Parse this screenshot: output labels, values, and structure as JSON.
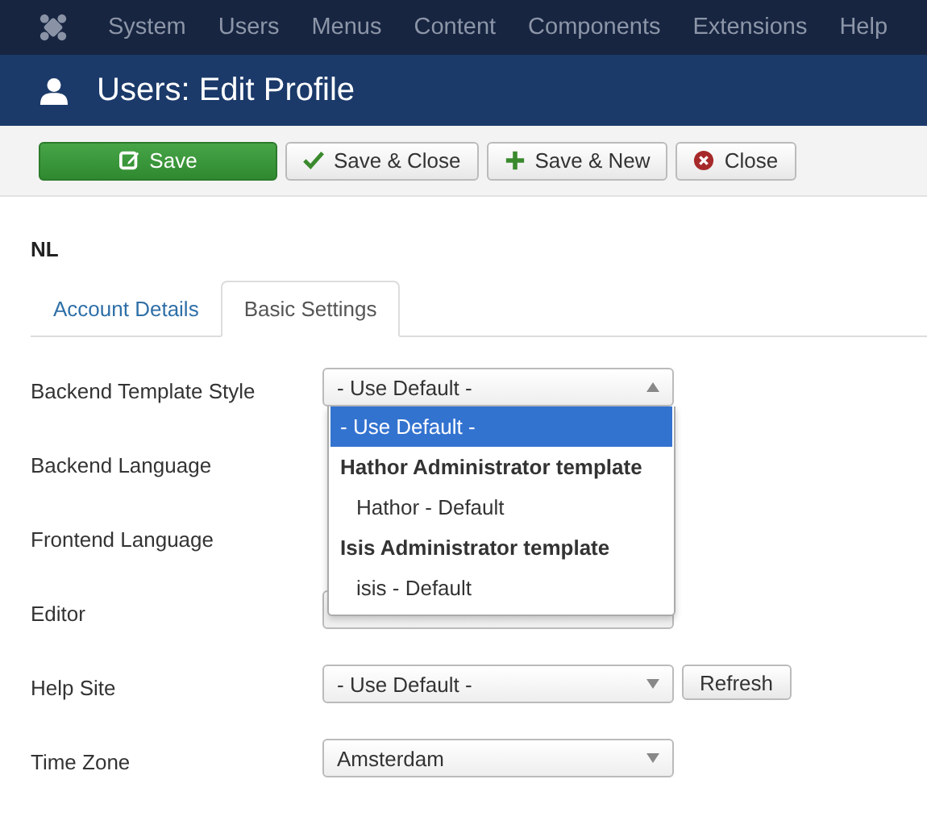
{
  "menu": {
    "items": [
      "System",
      "Users",
      "Menus",
      "Content",
      "Components",
      "Extensions",
      "Help"
    ]
  },
  "header": {
    "title": "Users: Edit Profile"
  },
  "toolbar": [
    {
      "label": "Save",
      "kind": "save"
    },
    {
      "label": "Save & Close",
      "kind": "check"
    },
    {
      "label": "Save & New",
      "kind": "plus"
    },
    {
      "label": "Close",
      "kind": "close"
    }
  ],
  "section_title": "NL",
  "tabs": [
    {
      "label": "Account Details",
      "selected": false
    },
    {
      "label": "Basic Settings",
      "selected": true
    }
  ],
  "fields": [
    {
      "label": "Backend Template Style",
      "kind": "select",
      "value": "- Use Default -",
      "open": true,
      "options": [
        {
          "text": "- Use Default -",
          "kind": "option",
          "selected": true
        },
        {
          "text": "Hathor Administrator template",
          "kind": "group",
          "selected": false
        },
        {
          "text": "Hathor - Default",
          "kind": "option",
          "selected": false
        },
        {
          "text": "Isis Administrator template",
          "kind": "group",
          "selected": false
        },
        {
          "text": "isis - Default",
          "kind": "option",
          "selected": false
        }
      ]
    },
    {
      "label": "Backend Language",
      "kind": "covered"
    },
    {
      "label": "Frontend Language",
      "kind": "covered"
    },
    {
      "label": "Editor",
      "kind": "select"
    },
    {
      "label": "Help Site",
      "kind": "select",
      "value": "- Use Default -",
      "button": "Refresh"
    },
    {
      "label": "Time Zone",
      "kind": "select",
      "value": "Amsterdam"
    }
  ]
}
